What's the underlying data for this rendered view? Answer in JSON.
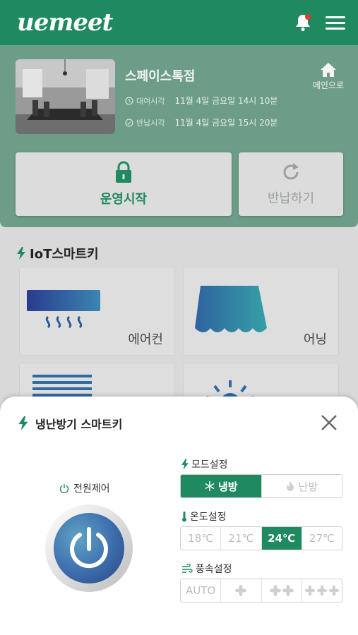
{
  "app": {
    "logo": "uemeet"
  },
  "header": {
    "bell_icon": "bell-icon",
    "menu_icon": "menu-icon",
    "notification_dot_color": "#e53935"
  },
  "reservation": {
    "space_name": "스페이스톡점",
    "rent_label": "대여시각",
    "rent_time": "11월 4일 금요일 14시 10분",
    "return_label": "반납시각",
    "return_time": "11월 4일 금요일 15시 20분",
    "home_label": "메인으로",
    "start_label": "운영시작",
    "return_button_label": "반납하기"
  },
  "iot": {
    "section_title": "IoT스마트키",
    "devices": [
      {
        "label": "에어컨",
        "icon": "air-conditioner-icon"
      },
      {
        "label": "어닝",
        "icon": "awning-icon"
      },
      {
        "label": "",
        "icon": "blinds-icon"
      },
      {
        "label": "",
        "icon": "light-icon"
      }
    ]
  },
  "smartkey": {
    "title": "냉난방기 스마트키",
    "power_label": "전원제어",
    "mode_label": "모드설정",
    "modes": [
      {
        "label": "냉방",
        "active": true
      },
      {
        "label": "난방",
        "active": false
      }
    ],
    "temp_label": "온도설정",
    "temps": [
      {
        "label": "18℃",
        "active": false
      },
      {
        "label": "21℃",
        "active": false
      },
      {
        "label": "24℃",
        "active": true
      },
      {
        "label": "27℃",
        "active": false
      }
    ],
    "fan_label": "풍속설정",
    "fan_speeds": [
      {
        "label": "AUTO",
        "icon": ""
      },
      {
        "label": "",
        "icon": "fan-1-icon"
      },
      {
        "label": "",
        "icon": "fan-2-icon"
      },
      {
        "label": "",
        "icon": "fan-3-icon"
      }
    ]
  },
  "colors": {
    "brand": "#1f8a60",
    "panel": "#6d9d88"
  }
}
